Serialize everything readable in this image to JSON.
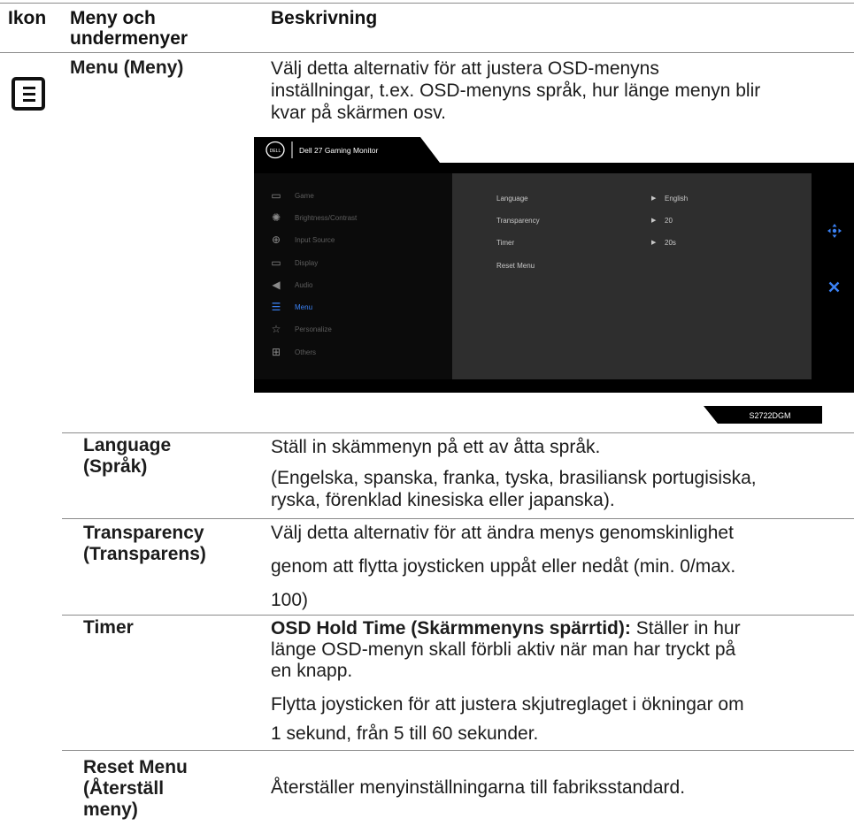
{
  "headers": {
    "icon": "Ikon",
    "menu_line1": "Meny och",
    "menu_line2": "undermenyer",
    "description": "Beskrivning"
  },
  "menu_row": {
    "icon": "menu-list-icon",
    "title": "Menu (Meny)",
    "description": [
      "Välj detta alternativ för att justera OSD-menyns",
      "inställningar, t.ex. OSD-menyns språk, hur länge menyn blir",
      "kvar på skärmen osv."
    ]
  },
  "osd": {
    "brand": "DELL",
    "product": "Dell 27 Gaming Monitor",
    "model": "S2722DGM",
    "menu_items": [
      {
        "label": "Game",
        "icon": "game-icon"
      },
      {
        "label": "Brightness/Contrast",
        "icon": "sun-icon"
      },
      {
        "label": "Input Source",
        "icon": "input-icon"
      },
      {
        "label": "Display",
        "icon": "monitor-icon"
      },
      {
        "label": "Audio",
        "icon": "speaker-icon"
      },
      {
        "label": "Menu",
        "icon": "menu-icon",
        "active": true
      },
      {
        "label": "Personalize",
        "icon": "star-icon"
      },
      {
        "label": "Others",
        "icon": "others-icon"
      }
    ],
    "settings": [
      {
        "name": "Language",
        "value": "English"
      },
      {
        "name": "Transparency",
        "value": "20"
      },
      {
        "name": "Timer",
        "value": "20s"
      },
      {
        "name": "Reset Menu",
        "value": ""
      }
    ],
    "accent_color": "#3b82f6"
  },
  "rows": {
    "language": {
      "name1": "Language",
      "name2": "(Språk)",
      "desc1": "Ställ in skämmenyn på ett av åtta språk.",
      "desc2": "(Engelska, spanska, franka, tyska, brasiliansk portugisiska,",
      "desc3": "ryska, förenklad kinesiska eller japanska)."
    },
    "transparency": {
      "name1": "Transparency",
      "name2": "(Transparens)",
      "desc1": "Välj detta alternativ för att ändra menys genomskinlighet",
      "desc2": "genom att flytta joysticken uppåt eller nedåt (min. 0/max.",
      "desc3": "100)"
    },
    "timer": {
      "name": "Timer",
      "bold": "OSD Hold Time (Skärmmenyns spärrtid):",
      "desc1_rest": " Ställer in hur",
      "desc2": "länge OSD-menyn skall förbli aktiv när man har tryckt på",
      "desc3": "en knapp.",
      "desc4": "Flytta joysticken för att justera skjutreglaget i ökningar om",
      "desc5": "1 sekund, från 5 till 60 sekunder."
    },
    "reset": {
      "name1": "Reset Menu",
      "name2": "(Återställ",
      "name3": "meny)",
      "desc": "Återställer menyinställningarna till fabriksstandard."
    }
  }
}
